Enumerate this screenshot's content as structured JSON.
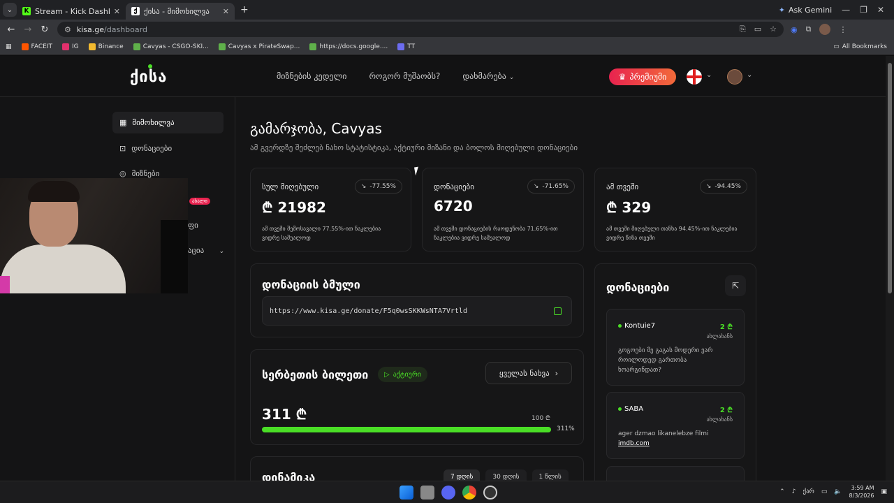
{
  "browser": {
    "tabs": [
      {
        "title": "Stream - Kick Dashboard",
        "icon": "kick-icon",
        "active": false
      },
      {
        "title": "ქისა - მიმოხილვა",
        "icon": "kisa-icon",
        "active": true
      }
    ],
    "ask_gemini": "Ask Gemini",
    "url_host": "kisa.ge",
    "url_path": "/dashboard",
    "bookmarks": [
      "FACEIT",
      "IG",
      "Binance",
      "Cavyas - CSGO-SKI...",
      "Cavyas x PirateSwap...",
      "https://docs.google....",
      "TT"
    ],
    "all_bookmarks": "All Bookmarks"
  },
  "nav": {
    "logo": "ქისა",
    "menu": [
      "მიზნების კედელი",
      "როგორ მუშაობს?",
      "დახმარება"
    ],
    "premium": "პრემიუმი"
  },
  "sidebar": {
    "items": [
      "მიმოხილვა",
      "დონაციები",
      "მიზნები"
    ],
    "partial_items": [
      "ფი",
      "აცია"
    ],
    "new_badge": "ახალი"
  },
  "main": {
    "greeting": "გამარჯობა, Cavyas",
    "subtitle": "ამ გვერდზე შეძლებ ნახო სტატისტიკა, აქტიური მიზანი და ბოლოს მიღებული დონაციები",
    "stats": [
      {
        "title": "სულ მიღებული",
        "change": "-77.55%",
        "value": "₾ 21982",
        "desc": "ამ თვეში შემოსავალი 77.55%-ით ნაკლებია ვიდრე საშუალოდ"
      },
      {
        "title": "დონაციები",
        "change": "-71.65%",
        "value": "6720",
        "desc": "ამ თვეში დონაციების რაოდენობა 71.65%-ით ნაკლებია ვიდრე საშუალოდ"
      },
      {
        "title": "ამ თვეში",
        "change": "-94.45%",
        "value": "₾ 329",
        "desc": "ამ თვეში მიღებული თანხა 94.45%-ით ნაკლებია ვიდრე წინა თვეში"
      }
    ],
    "donation_link": {
      "title": "დონაციის ბმული",
      "url": "https://www.kisa.ge/donate/F5q0wsSKKWsNTA7Vrtld"
    },
    "goal": {
      "title": "სერბეთის ბილეთი",
      "status": "აქტიური",
      "see_all": "ყველას ნახვა",
      "amount": "311 ₾",
      "target": "100 ₾",
      "percent_label": "311%",
      "progress": 1.0
    },
    "dynamics": {
      "title": "დინამიკა",
      "ranges": [
        "7 დღის",
        "30 დღის",
        "1 წლის"
      ]
    }
  },
  "donations": {
    "title": "დონაციები",
    "items": [
      {
        "name": "Kontuie7",
        "amount": "2 ₾",
        "time": "ახლახანს",
        "message": "გოგოები მე გაგას მოდერი ვარ როილოდედ გართობა ხოარგინდათ?",
        "link": ""
      },
      {
        "name": "SABA",
        "amount": "2 ₾",
        "time": "ახლახანს",
        "message": "ager dzmao likanelebze filmi",
        "link": "imdb.com"
      }
    ]
  },
  "taskbar": {
    "lang": "ქარ",
    "time": "3:59 AM",
    "date": "8/3/2026"
  }
}
